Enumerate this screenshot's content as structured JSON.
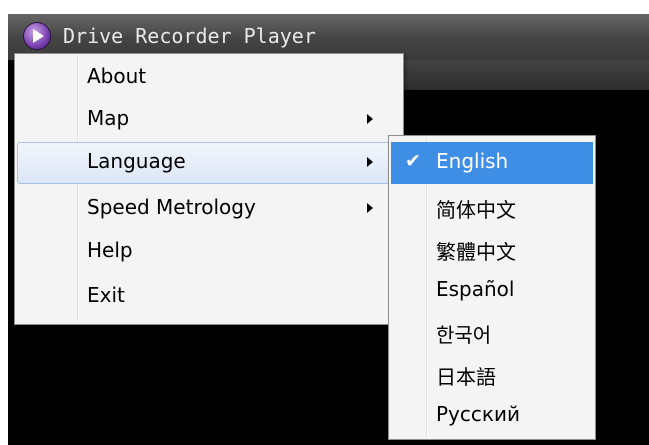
{
  "window": {
    "title": "Drive Recorder Player",
    "icon": "play-logo-icon"
  },
  "main_menu": {
    "items": [
      {
        "label": "About",
        "has_submenu": false
      },
      {
        "label": "Map",
        "has_submenu": true
      },
      {
        "label": "Language",
        "has_submenu": true,
        "highlighted": true
      },
      {
        "label": "Speed Metrology",
        "has_submenu": true
      },
      {
        "label": "Help",
        "has_submenu": false
      },
      {
        "label": "Exit",
        "has_submenu": false
      }
    ]
  },
  "language_menu": {
    "selected": "English",
    "items": [
      {
        "label": "English",
        "checked": true
      },
      {
        "label": "简体中文",
        "checked": false
      },
      {
        "label": "繁體中文",
        "checked": false
      },
      {
        "label": "Español",
        "checked": false
      },
      {
        "label": "한국어",
        "checked": false
      },
      {
        "label": "日本語",
        "checked": false
      },
      {
        "label": "Русский",
        "checked": false
      }
    ]
  },
  "colors": {
    "selection": "#3f8ee6",
    "hover_border": "#a8c1e8",
    "menu_background": "#f4f4f4",
    "titlebar": "#4a4a4a",
    "video_area": "#000000"
  }
}
